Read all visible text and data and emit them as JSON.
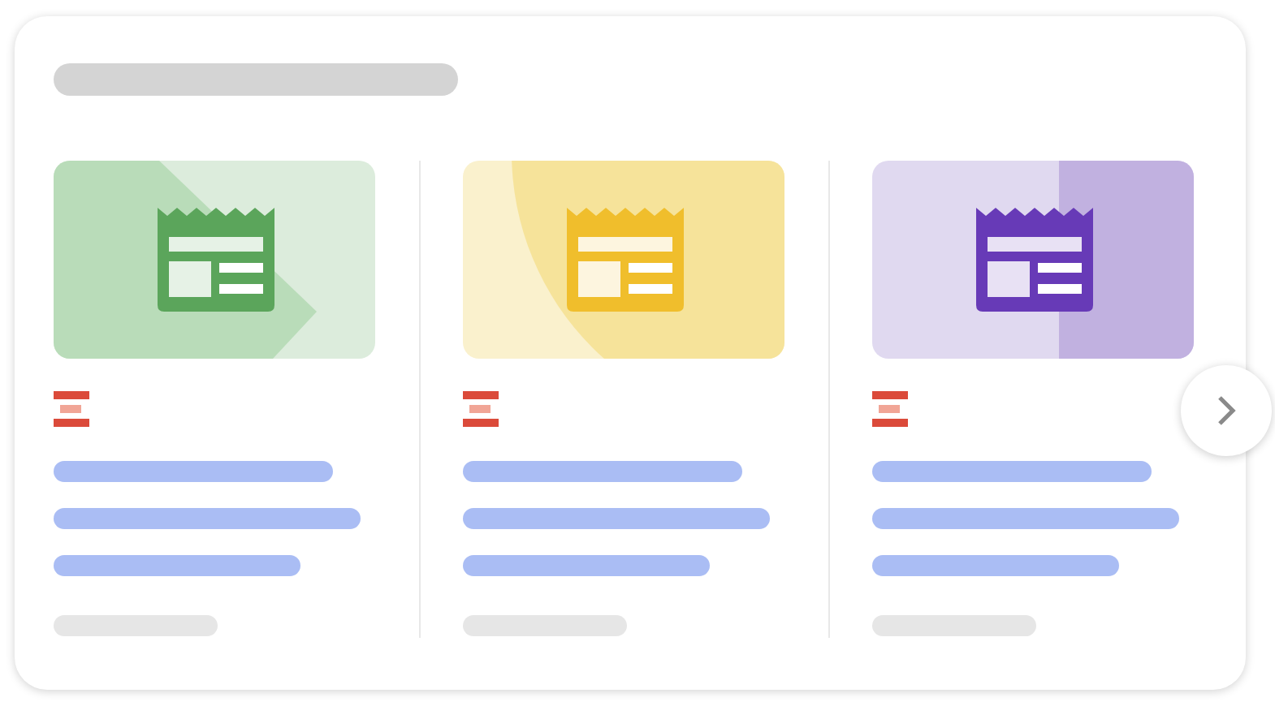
{
  "cards": [
    {
      "kind": "diagonal",
      "color": "#5ba55b"
    },
    {
      "kind": "circle",
      "color": "#f0be2c"
    },
    {
      "kind": "split",
      "color": "#673ab7"
    }
  ]
}
